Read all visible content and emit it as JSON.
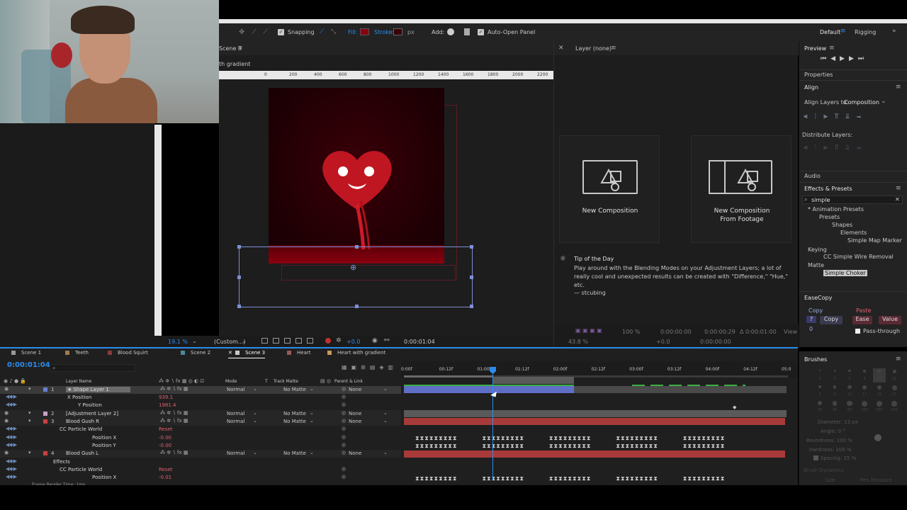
{
  "toolbar": {
    "snapping": "Snapping",
    "fill": "Fill:",
    "stroke": "Stroke:",
    "px": "px",
    "add": "Add:",
    "auto_open": "Auto-Open Panel",
    "workspace_default": "Default",
    "workspace_rigging": "Rigging"
  },
  "comp_panel": {
    "tab": "Scene 3",
    "breadcrumb": "th gradient",
    "ruler_ticks": [
      "0",
      "200",
      "400",
      "600",
      "800",
      "1000",
      "1200",
      "1400",
      "1600",
      "1800",
      "2000",
      "2200"
    ],
    "zoom": "19.1 %",
    "resolution": "(Custom...)",
    "exposure": "+0.0",
    "timecode": "0:00:01:04"
  },
  "layer_panel": {
    "title": "Layer (none)",
    "new_comp": "New Composition",
    "new_comp_footage_1": "New Composition",
    "new_comp_footage_2": "From Footage",
    "tip_title": "Tip of the Day",
    "tip_body": "Play around with the Blending Modes on your Adjustment Layers; a lot of really cool and unexpected results can be created with \"Difference,\" \"Hue,\" etc.",
    "tip_author": "— stcubing",
    "footer_zoom": "100 %",
    "footer_in": "0:00:00:00",
    "footer_out": "0:00:00:29",
    "footer_dur": "Δ 0:00:01:00",
    "footer_view": "View",
    "footer_zoom2": "43.8 %",
    "footer_exposure": "+0.0",
    "footer_tc": "0:00:00:00"
  },
  "right_panel": {
    "preview": "Preview",
    "properties": "Properties",
    "align": "Align",
    "align_to_label": "Align Layers to:",
    "align_to_value": "Composition",
    "distribute": "Distribute Layers:",
    "audio": "Audio",
    "effects_presets": "Effects & Presets",
    "search_value": "simple",
    "tree": [
      "* Animation Presets",
      "Presets",
      "Shapes",
      "Elements",
      "Simple Map Marker",
      "Keying",
      "CC Simple Wire Removal",
      "Matte",
      "Simple Choker"
    ],
    "easecopy": "EaseCopy",
    "copy_label": "Copy",
    "copy_btn": "Copy",
    "paste_label": "Paste",
    "ease_btn": "Ease",
    "value_btn": "Value",
    "q_label": "?",
    "zero": "0",
    "pass_through": "Pass-through",
    "brushes": "Brushes",
    "brush_sizes": [
      "1",
      "3",
      "5",
      "9",
      "13",
      "19",
      "5",
      "9",
      "13",
      "17",
      "21",
      "27",
      "35",
      "45",
      "65",
      "100",
      "200",
      "300"
    ],
    "diameter": "Diameter: 13 px",
    "angle": "Angle: 0 °",
    "roundness": "Roundness: 100 %",
    "hardness": "Hardness: 100 %",
    "spacing": "Spacing: 25 %",
    "brush_dynamics": "Brush Dynamics",
    "size": "Size",
    "pen_pressure": "Pen Pressure"
  },
  "timeline": {
    "tabs": [
      "Scene 1",
      "Teeth",
      "Blood Squirt",
      "Scene 2",
      "Scene 3",
      "Heart",
      "Heart with gradient"
    ],
    "tab_colors": [
      "#9a9a9a",
      "#a07a4a",
      "#8a3a3a",
      "#4a8a9a",
      "#c8c8c8",
      "#9a5a5a",
      "#c89a5a"
    ],
    "current_time": "0:00:01:04",
    "columns": {
      "layer_name": "Layer Name",
      "mode": "Mode",
      "t": "T",
      "track_matte": "Track Matte",
      "parent": "Parent & Link"
    },
    "ruler": [
      "0:00f",
      "00:12f",
      "01:00f",
      "01:12f",
      "02:00f",
      "02:12f",
      "03:00f",
      "03:12f",
      "04:00f",
      "04:12f",
      "05:0"
    ],
    "layers": [
      {
        "num": "1",
        "name": "★ Shape Layer 1",
        "mode": "Normal",
        "matte": "No Matte",
        "parent": "None",
        "color": "#6b7fd6"
      },
      {
        "num": "",
        "name": "X Position",
        "value": "939.1"
      },
      {
        "num": "",
        "name": "Y Position",
        "value": "1981.4"
      },
      {
        "num": "2",
        "name": "[Adjustment Layer 2]",
        "mode": "Normal",
        "matte": "No Matte",
        "parent": "None",
        "color": "#c8a0c8"
      },
      {
        "num": "3",
        "name": "Blood Gush R",
        "mode": "Normal",
        "matte": "No Matte",
        "parent": "None",
        "color": "#c84040"
      },
      {
        "num": "",
        "name": "CC Particle World",
        "value": "Reset"
      },
      {
        "num": "",
        "name": "Position X",
        "value": "-0.00"
      },
      {
        "num": "",
        "name": "Position Y",
        "value": "-0.00"
      },
      {
        "num": "4",
        "name": "Blood Gush L",
        "mode": "Normal",
        "matte": "No Matte",
        "parent": "None",
        "color": "#c84040"
      },
      {
        "num": "",
        "name": "Effects",
        "value": ""
      },
      {
        "num": "",
        "name": "CC Particle World",
        "value": "Reset"
      },
      {
        "num": "",
        "name": "Position X",
        "value": "-0.01"
      }
    ],
    "footer": "Frame Render Time: 1ms"
  },
  "colors": {
    "accent_blue": "#2d8ceb",
    "layer_blue": "#6b7fd6",
    "layer_red": "#a83a3a",
    "green_bar": "#3cb043",
    "heart_red": "#c01622",
    "bg_red": "#2a0004"
  }
}
